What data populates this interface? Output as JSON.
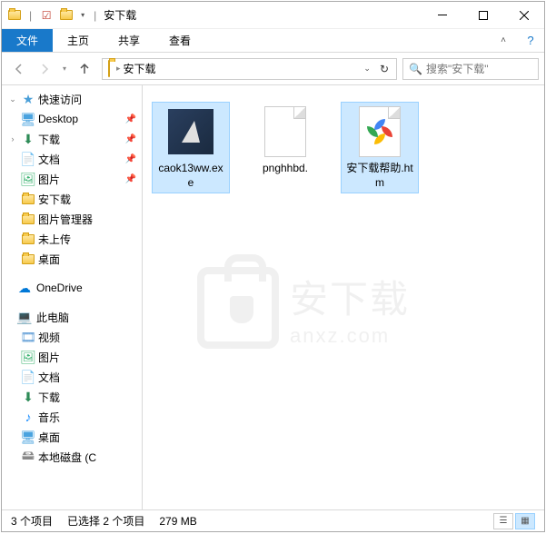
{
  "window": {
    "title": "安下载"
  },
  "ribbon": {
    "file": "文件",
    "tabs": [
      "主页",
      "共享",
      "查看"
    ]
  },
  "nav": {
    "breadcrumb": "安下载",
    "search_placeholder": "搜索\"安下载\""
  },
  "sidebar": {
    "quick_access": "快速访问",
    "quick_items": [
      {
        "label": "Desktop",
        "icon": "desktop",
        "pinned": true
      },
      {
        "label": "下载",
        "icon": "download",
        "pinned": true
      },
      {
        "label": "文档",
        "icon": "document",
        "pinned": true
      },
      {
        "label": "图片",
        "icon": "picture",
        "pinned": true
      },
      {
        "label": "安下载",
        "icon": "folder",
        "pinned": false
      },
      {
        "label": "图片管理器",
        "icon": "folder",
        "pinned": false
      },
      {
        "label": "未上传",
        "icon": "folder",
        "pinned": false
      },
      {
        "label": "桌面",
        "icon": "folder",
        "pinned": false
      }
    ],
    "onedrive": "OneDrive",
    "this_pc": "此电脑",
    "pc_items": [
      {
        "label": "视频",
        "icon": "video"
      },
      {
        "label": "图片",
        "icon": "picture"
      },
      {
        "label": "文档",
        "icon": "document"
      },
      {
        "label": "下载",
        "icon": "download"
      },
      {
        "label": "音乐",
        "icon": "music"
      },
      {
        "label": "桌面",
        "icon": "desktop"
      },
      {
        "label": "本地磁盘 (C",
        "icon": "disk"
      }
    ]
  },
  "files": [
    {
      "name": "caok13ww.exe",
      "selected": true,
      "type": "exe"
    },
    {
      "name": "pnghhbd.",
      "selected": false,
      "type": "blank"
    },
    {
      "name": "安下载帮助.htm",
      "selected": true,
      "type": "htm"
    }
  ],
  "watermark": {
    "cn": "安下载",
    "en": "anxz.com"
  },
  "status": {
    "count": "3 个项目",
    "selection": "已选择 2 个项目",
    "size": "279 MB"
  }
}
